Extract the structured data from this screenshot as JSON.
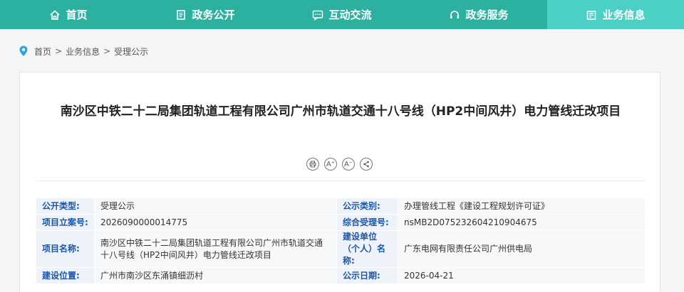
{
  "nav": {
    "items": [
      {
        "label": "首页",
        "icon": "home-icon"
      },
      {
        "label": "政务公开",
        "icon": "document-icon"
      },
      {
        "label": "互动交流",
        "icon": "chat-icon"
      },
      {
        "label": "政务服务",
        "icon": "headset-icon"
      },
      {
        "label": "业务信息",
        "icon": "briefcase-icon"
      }
    ],
    "active_index": 4,
    "color": "#2cb0a0",
    "active_color": "#4ccfc4"
  },
  "breadcrumb": {
    "items": [
      "首页",
      "业务信息",
      "受理公示"
    ],
    "separator": ">"
  },
  "article": {
    "title": "南沙区中铁二十二局集团轨道工程有限公司广州市轨道交通十八号线（HP2中间风井）电力管线迁改项目",
    "tools": [
      {
        "icon": "print-icon",
        "glyph": "⎙"
      },
      {
        "icon": "font-increase-icon",
        "glyph": "A⁺"
      },
      {
        "icon": "font-decrease-icon",
        "glyph": "A⁻"
      },
      {
        "icon": "share-icon",
        "glyph": "⋖"
      }
    ]
  },
  "info": {
    "rows": [
      {
        "k1": "公开类型:",
        "v1": "受理公示",
        "k2": "公示类别:",
        "v2": "办理管线工程《建设工程规划许可证》"
      },
      {
        "k1": "项目立案号:",
        "v1": "2026090000014775",
        "k2": "综合受理号:",
        "v2": "nsMB2D075232604210904675"
      },
      {
        "k1": "项目名称:",
        "v1": "南沙区中铁二十二局集团轨道工程有限公司广州市轨道交通十八号线（HP2中间风井）电力管线迁改项目",
        "k2": "建设单位（个人）名称:",
        "v2": "广东电网有限责任公司广州供电局"
      },
      {
        "k1": "建设位置:",
        "v1": "广州市南沙区东涌镇细沥村",
        "k2": "公示日期:",
        "v2": "2026-04-21"
      }
    ]
  }
}
